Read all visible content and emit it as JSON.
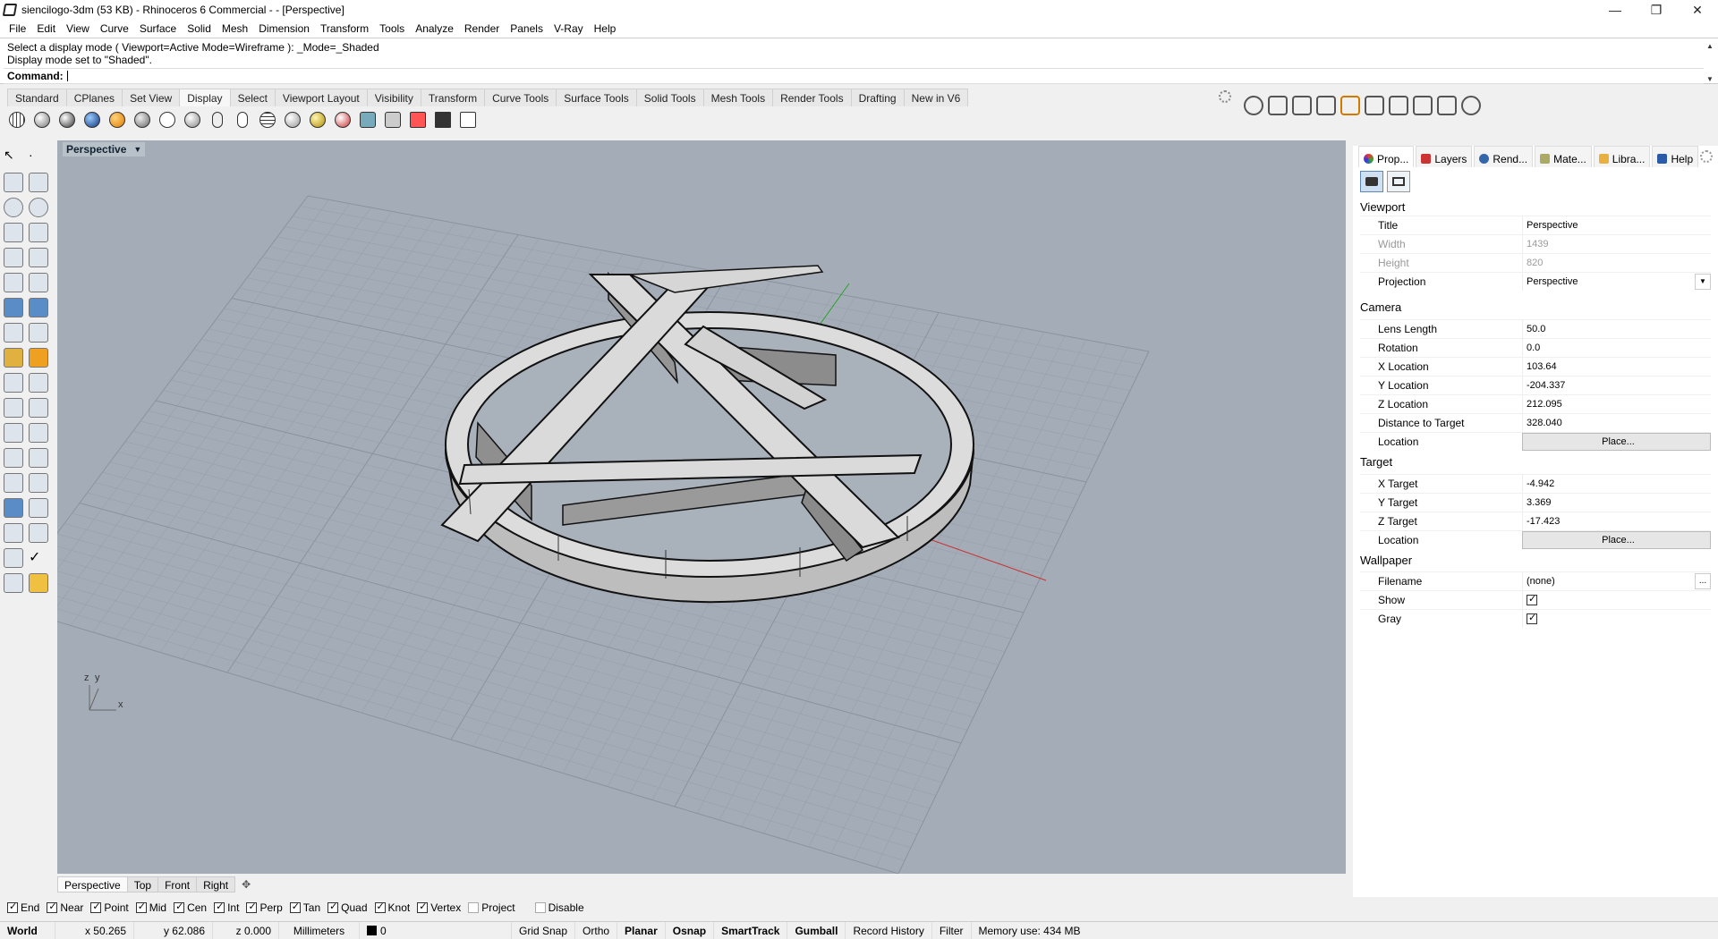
{
  "titlebar": {
    "title": "siencilogo-3dm (53 KB) - Rhinoceros 6 Commercial - - [Perspective]",
    "minimize": "—",
    "restore": "❐",
    "close": "✕"
  },
  "menu": [
    "File",
    "Edit",
    "View",
    "Curve",
    "Surface",
    "Solid",
    "Mesh",
    "Dimension",
    "Transform",
    "Tools",
    "Analyze",
    "Render",
    "Panels",
    "V-Ray",
    "Help"
  ],
  "command": {
    "history_1": "Select a display mode ( Viewport=Active  Mode=Wireframe ): _Mode=_Shaded",
    "history_2": "Display mode set to \"Shaded\".",
    "prompt": "Command:"
  },
  "toolbar_tabs": [
    "Standard",
    "CPlanes",
    "Set View",
    "Display",
    "Select",
    "Viewport Layout",
    "Visibility",
    "Transform",
    "Curve Tools",
    "Surface Tools",
    "Solid Tools",
    "Mesh Tools",
    "Render Tools",
    "Drafting",
    "New in V6"
  ],
  "toolbar_active": "Display",
  "viewport": {
    "label": "Perspective",
    "axis_z": "z",
    "axis_y": "y",
    "axis_x": "x",
    "background": "#a4adb7"
  },
  "viewport_tabs": [
    "Perspective",
    "Top",
    "Front",
    "Right"
  ],
  "osnaps": [
    {
      "label": "End",
      "checked": true
    },
    {
      "label": "Near",
      "checked": true
    },
    {
      "label": "Point",
      "checked": true
    },
    {
      "label": "Mid",
      "checked": true
    },
    {
      "label": "Cen",
      "checked": true
    },
    {
      "label": "Int",
      "checked": true
    },
    {
      "label": "Perp",
      "checked": true
    },
    {
      "label": "Tan",
      "checked": true
    },
    {
      "label": "Quad",
      "checked": true
    },
    {
      "label": "Knot",
      "checked": true
    },
    {
      "label": "Vertex",
      "checked": true
    },
    {
      "label": "Project",
      "checked": false
    },
    {
      "label": "Disable",
      "checked": false
    }
  ],
  "status": {
    "cplane": "World",
    "x": "x 50.265",
    "y": "y 62.086",
    "z": "z 0.000",
    "units": "Millimeters",
    "layer": "0",
    "grid_snap": "Grid Snap",
    "ortho": "Ortho",
    "planar": "Planar",
    "osnap": "Osnap",
    "smarttrack": "SmartTrack",
    "gumball": "Gumball",
    "record_history": "Record History",
    "filter": "Filter",
    "memory": "Memory use: 434 MB"
  },
  "panel": {
    "tabs": [
      "Prop...",
      "Layers",
      "Rend...",
      "Mate...",
      "Libra...",
      "Help"
    ],
    "sections": {
      "viewport": "Viewport",
      "camera": "Camera",
      "target": "Target",
      "wallpaper": "Wallpaper"
    },
    "viewport_rows": [
      {
        "key": "Title",
        "value": "Perspective"
      },
      {
        "key": "Width",
        "value": "1439"
      },
      {
        "key": "Height",
        "value": "820"
      },
      {
        "key": "Projection",
        "value": "Perspective"
      }
    ],
    "camera_rows": [
      {
        "key": "Lens Length",
        "value": "50.0"
      },
      {
        "key": "Rotation",
        "value": "0.0"
      },
      {
        "key": "X Location",
        "value": "103.64"
      },
      {
        "key": "Y Location",
        "value": "-204.337"
      },
      {
        "key": "Z Location",
        "value": "212.095"
      },
      {
        "key": "Distance to Target",
        "value": "328.040"
      },
      {
        "key": "Location",
        "value": "Place..."
      }
    ],
    "target_rows": [
      {
        "key": "X Target",
        "value": "-4.942"
      },
      {
        "key": "Y Target",
        "value": "3.369"
      },
      {
        "key": "Z Target",
        "value": "-17.423"
      },
      {
        "key": "Location",
        "value": "Place..."
      }
    ],
    "wallpaper_rows": [
      {
        "key": "Filename",
        "value": "(none)"
      },
      {
        "key": "Show",
        "value": ""
      },
      {
        "key": "Gray",
        "value": ""
      }
    ],
    "ellipsis": "...",
    "dropdown": "▼"
  }
}
